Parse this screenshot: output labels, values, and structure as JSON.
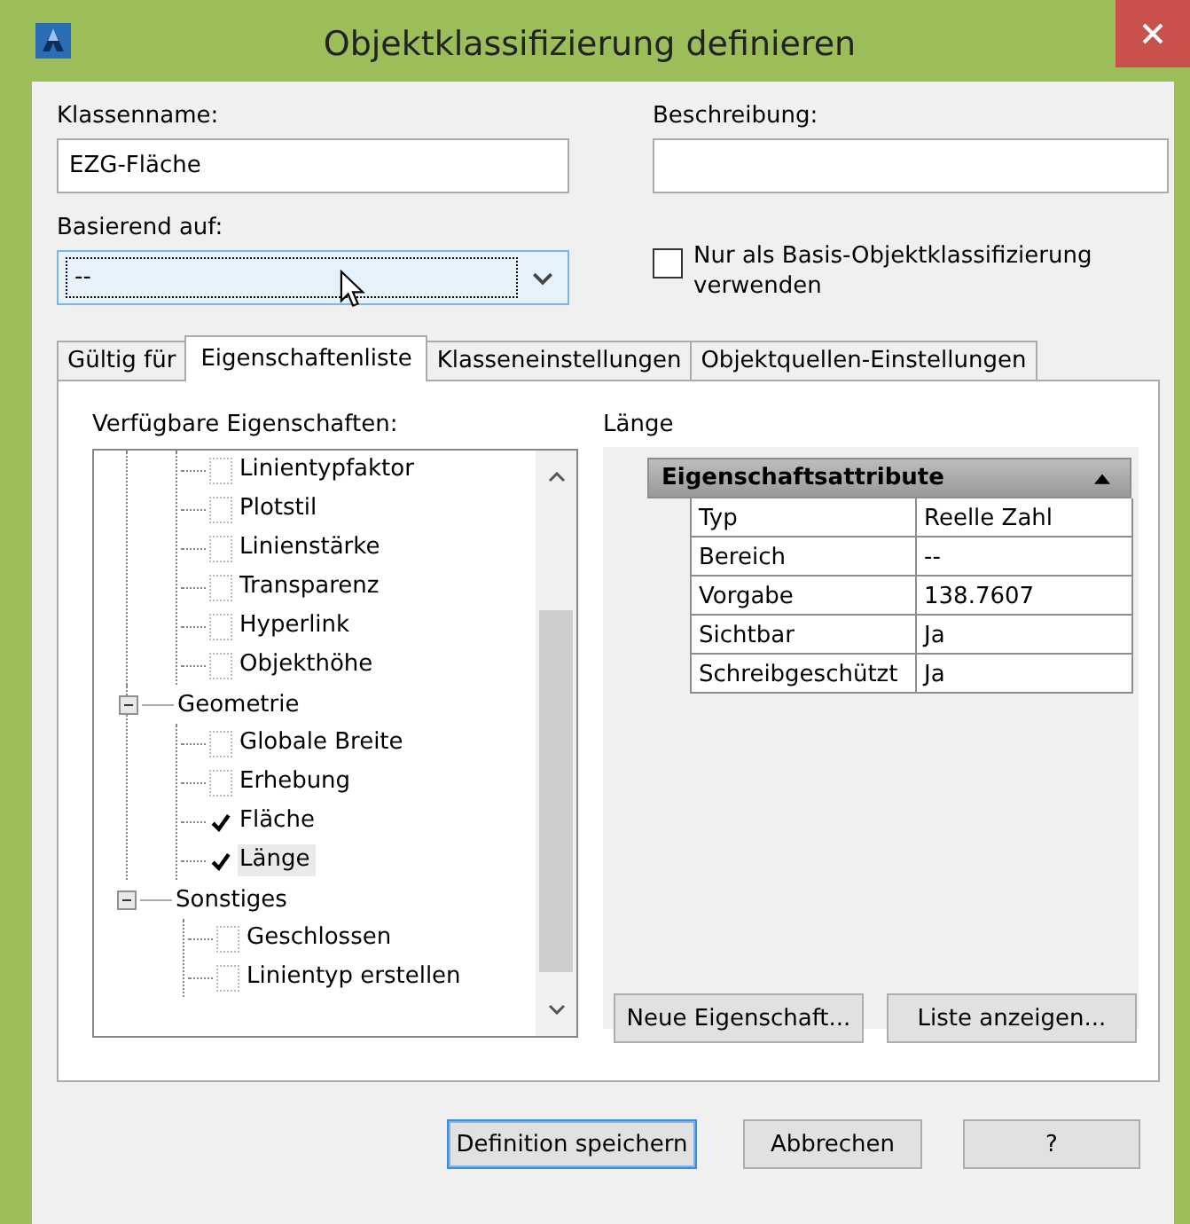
{
  "window": {
    "title": "Objektklassifizierung definieren"
  },
  "fields": {
    "class_name": {
      "label": "Klassenname:",
      "value": "EZG-Fläche"
    },
    "description": {
      "label": "Beschreibung:"
    },
    "based_on": {
      "label": "Basierend auf:",
      "value": "--",
      "focused": true
    },
    "base_only": {
      "label": "Nur als Basis-Objektklassifizierung verwenden",
      "checked": false
    }
  },
  "tabs": [
    {
      "label": "Gültig für",
      "selected": false
    },
    {
      "label": "Eigenschaftenliste",
      "selected": true
    },
    {
      "label": "Klasseneinstellungen",
      "selected": false
    },
    {
      "label": "Objektquellen-Einstellungen",
      "selected": false
    }
  ],
  "tree": {
    "label": "Verfügbare Eigenschaften:",
    "items": [
      {
        "children": [
          {
            "label": "Linientypfaktor",
            "checked": false,
            "selected": false
          },
          {
            "label": "Plotstil",
            "checked": false,
            "selected": false
          },
          {
            "label": "Linienstärke",
            "checked": false,
            "selected": false
          },
          {
            "label": "Transparenz",
            "checked": false,
            "selected": false
          },
          {
            "label": "Hyperlink",
            "checked": false,
            "selected": false
          },
          {
            "label": "Objekthöhe",
            "checked": false,
            "selected": false
          }
        ]
      },
      {
        "label": "Geometrie",
        "expanded": true,
        "children": [
          {
            "label": "Globale Breite",
            "checked": false,
            "selected": false
          },
          {
            "label": "Erhebung",
            "checked": false,
            "selected": false
          },
          {
            "label": "Fläche",
            "checked": true,
            "selected": false
          },
          {
            "label": "Länge",
            "checked": true,
            "selected": true
          }
        ]
      },
      {
        "label": "Sonstiges",
        "expanded": true,
        "children": [
          {
            "label": "Geschlossen",
            "checked": false,
            "selected": false
          },
          {
            "label": "Linientyp erstellen",
            "checked": false,
            "selected": false
          }
        ]
      }
    ]
  },
  "details": {
    "title": "Länge",
    "grid_header": "Eigenschaftsattribute",
    "expanded": true,
    "rows": [
      {
        "name": "Typ",
        "value": "Reelle Zahl"
      },
      {
        "name": "Bereich",
        "value": "--"
      },
      {
        "name": "Vorgabe",
        "value": "138.7607"
      },
      {
        "name": "Sichtbar",
        "value": "Ja"
      },
      {
        "name": "Schreibgeschützt",
        "value": "Ja"
      }
    ]
  },
  "panel_buttons": [
    "Neue Eigenschaft...",
    "Liste anzeigen..."
  ],
  "buttons": [
    {
      "label": "Definition speichern",
      "default": true
    },
    {
      "label": "Abbrechen",
      "default": false
    },
    {
      "label": "?",
      "default": false
    }
  ]
}
